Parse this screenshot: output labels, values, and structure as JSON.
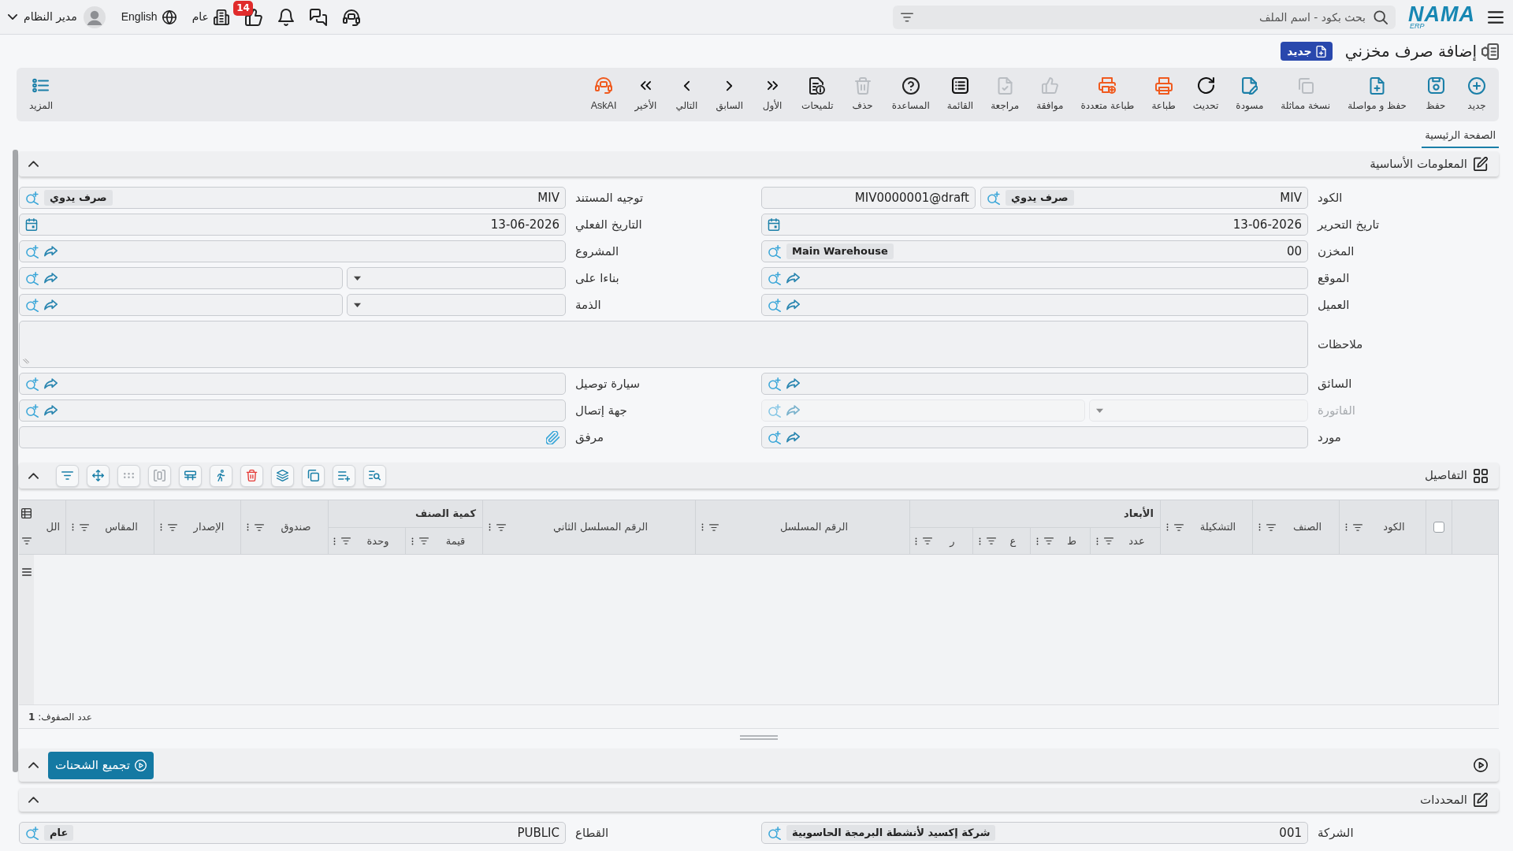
{
  "topbar": {
    "logo": {
      "text": "NAMA",
      "subtext": "ERP"
    },
    "search": {
      "placeholder": "بحث بكود - اسم الملف"
    },
    "notifications": "14",
    "branch": "عام",
    "language": "English",
    "user": "مدير النظام"
  },
  "page": {
    "title": "إضافة صرف مخزني",
    "status": "جديد"
  },
  "toolbar": [
    {
      "kind": "new",
      "label": "جديد",
      "disabled": false
    },
    {
      "kind": "save",
      "label": "حفظ",
      "disabled": false
    },
    {
      "kind": "save_continue",
      "label": "حفظ و مواصلة",
      "disabled": false
    },
    {
      "kind": "duplicate",
      "label": "نسخة مماثلة",
      "disabled": true
    },
    {
      "kind": "draft",
      "label": "مسودة",
      "disabled": false
    },
    {
      "kind": "refresh",
      "label": "تحديث",
      "disabled": false
    },
    {
      "kind": "print",
      "label": "طباعة",
      "disabled": false
    },
    {
      "kind": "print_multi",
      "label": "طباعة متعددة",
      "disabled": false
    },
    {
      "kind": "approve",
      "label": "موافقة",
      "disabled": true
    },
    {
      "kind": "review",
      "label": "مراجعة",
      "disabled": true
    },
    {
      "kind": "list",
      "label": "القائمة",
      "disabled": false
    },
    {
      "kind": "help",
      "label": "المساعدة",
      "disabled": false
    },
    {
      "kind": "delete",
      "label": "حذف",
      "disabled": true
    },
    {
      "kind": "tips",
      "label": "تلميحات",
      "disabled": false
    },
    {
      "kind": "first",
      "label": "الأول",
      "disabled": false
    },
    {
      "kind": "previous",
      "label": "السابق",
      "disabled": false
    },
    {
      "kind": "next",
      "label": "التالي",
      "disabled": false
    },
    {
      "kind": "last",
      "label": "الأخير",
      "disabled": false
    },
    {
      "kind": "askai",
      "label": "AskAI",
      "disabled": false
    }
  ],
  "more": {
    "label": "المزيد"
  },
  "tabs": [
    {
      "label": "الصفحة الرئيسية",
      "selected": true
    }
  ],
  "basic_info": {
    "title": "المعلومات الأساسية",
    "fields": [
      {
        "label": "الكود",
        "kind": "code",
        "value": "MIV",
        "chip": "صرف يدوي",
        "serial": "MIV0000001@draft",
        "disabled": false
      },
      {
        "label": "توجيه المستند",
        "kind": "lookup_chip",
        "value": "MIV",
        "chip": "صرف يدوي",
        "disabled": false
      },
      {
        "label": "تاريخ التحرير",
        "kind": "date",
        "value": "13-06-2026",
        "disabled": false
      },
      {
        "label": "التاريخ الفعلي",
        "kind": "date",
        "value": "13-06-2026",
        "disabled": false
      },
      {
        "label": "المخزن",
        "kind": "lookup_chip",
        "value": "00",
        "chip": "Main Warehouse",
        "disabled": false
      },
      {
        "label": "المشروع",
        "kind": "lookup",
        "disabled": false
      },
      {
        "label": "الموقع",
        "kind": "lookup",
        "disabled": false
      },
      {
        "label": "بناءا على",
        "kind": "select_lookup",
        "disabled": false
      },
      {
        "label": "العميل",
        "kind": "lookup",
        "disabled": false
      },
      {
        "label": "الذمة",
        "kind": "select_lookup",
        "disabled": false
      },
      {
        "label": "ملاحظات",
        "kind": "textarea",
        "disabled": false
      },
      {
        "label": "السائق",
        "kind": "lookup",
        "disabled": false
      },
      {
        "label": "سيارة توصيل",
        "kind": "lookup",
        "disabled": false
      },
      {
        "label": "الفاتورة",
        "kind": "select_lookup",
        "disabled": true
      },
      {
        "label": "جهة إتصال",
        "kind": "lookup",
        "disabled": false
      },
      {
        "label": "مورد",
        "kind": "lookup",
        "disabled": false
      },
      {
        "label": "مرفق",
        "kind": "attachment",
        "disabled": false
      }
    ]
  },
  "details": {
    "title": "التفاصيل",
    "tools": [
      {
        "kind": "find",
        "disabled": false
      },
      {
        "kind": "add_row",
        "disabled": false
      },
      {
        "kind": "copy",
        "disabled": false
      },
      {
        "kind": "layers",
        "disabled": false
      },
      {
        "kind": "delete",
        "disabled": false
      },
      {
        "kind": "run",
        "disabled": false
      },
      {
        "kind": "rows",
        "disabled": false
      },
      {
        "kind": "columns",
        "disabled": true
      },
      {
        "kind": "dots",
        "disabled": true
      },
      {
        "kind": "move",
        "disabled": false
      },
      {
        "kind": "filter",
        "disabled": false
      }
    ],
    "table": {
      "select_all": {
        "checked": false
      },
      "columns": [
        {
          "label": "الكود"
        },
        {
          "label": "الصنف"
        },
        {
          "label": "التشكيلة"
        },
        {
          "label": "الأبعاد",
          "children": [
            {
              "label": "عدد"
            },
            {
              "label": "ط"
            },
            {
              "label": "ع"
            },
            {
              "label": "ر"
            }
          ]
        },
        {
          "label": "الرقم المسلسل"
        },
        {
          "label": "الرقم المسلسل الثاني"
        },
        {
          "label": "كمية الصنف",
          "children": [
            {
              "label": "قيمة"
            },
            {
              "label": "وحدة"
            }
          ]
        },
        {
          "label": "صندوق"
        },
        {
          "label": "الإصدار"
        },
        {
          "label": "المقاس"
        },
        {
          "label": "الل"
        }
      ],
      "row_count": "عدد الصفوف: **1**"
    }
  },
  "shipments": {
    "button": "تجميع الشحنات"
  },
  "determinants": {
    "title": "المحددات",
    "fields": [
      {
        "label": "الشركة",
        "kind": "lookup_chip",
        "value": "001",
        "chip": "شركة إكسيد لأنشطة البرمجة الحاسوبية",
        "disabled": false
      },
      {
        "label": "القطاع",
        "kind": "lookup_chip",
        "value": "PUBLIC",
        "chip": "عام",
        "disabled": false
      }
    ]
  }
}
